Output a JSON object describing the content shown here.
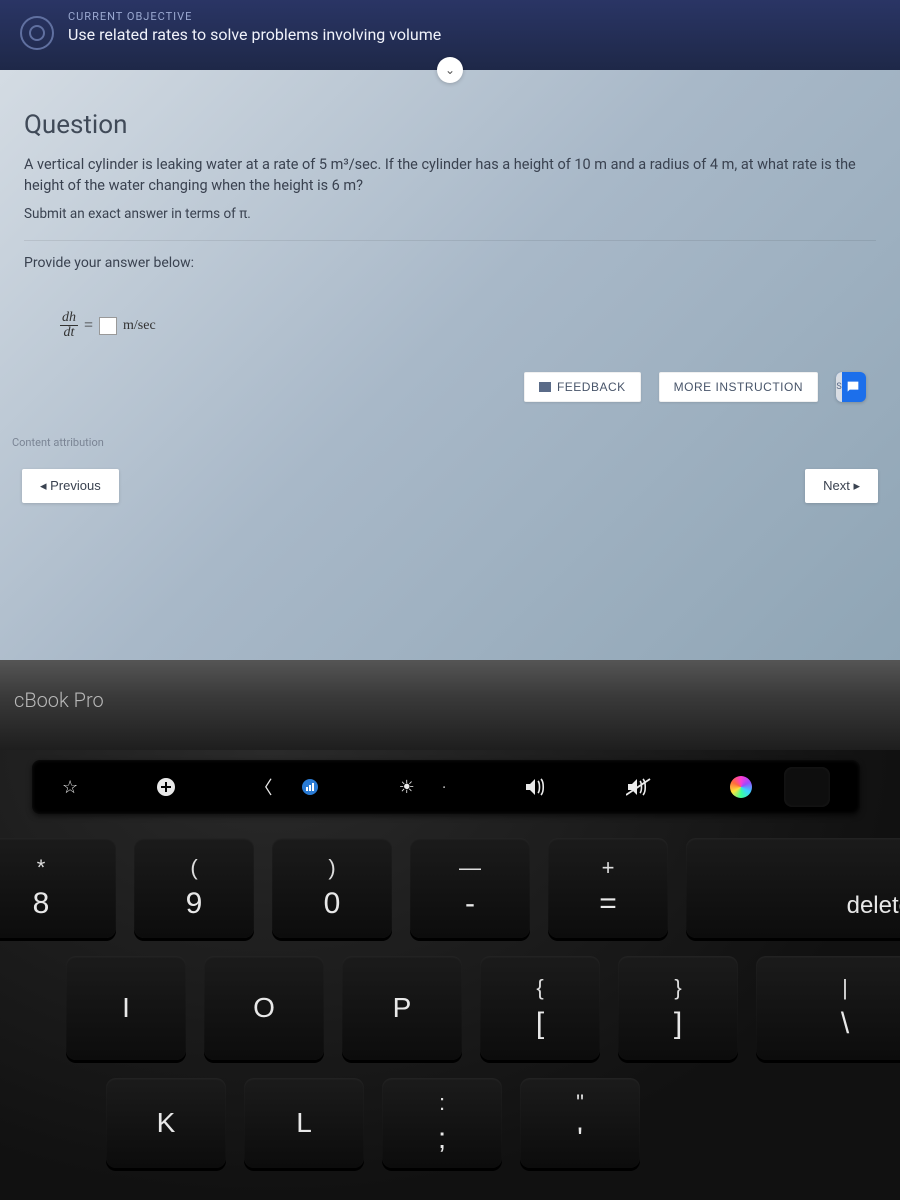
{
  "header": {
    "label": "CURRENT OBJECTIVE",
    "text": "Use related rates to solve problems involving volume"
  },
  "question": {
    "title": "Question",
    "body": "A vertical cylinder is leaking water at a rate of 5 m³/sec. If the cylinder has a height of 10 m and a radius of 4 m, at what rate is the height of the water changing when the height is 6 m?",
    "hint": "Submit an exact answer in terms of π.",
    "provide": "Provide your answer below:",
    "equation": {
      "lhs_num": "dh",
      "lhs_den": "dt",
      "eq": "=",
      "unit": "m/sec"
    }
  },
  "actions": {
    "feedback": "FEEDBACK",
    "more": "MORE INSTRUCTION",
    "sub_letter": "S"
  },
  "attribution": "Content attribution",
  "nav": {
    "prev": "◂ Previous",
    "next": "Next ▸"
  },
  "laptop_model": "cBook Pro",
  "touchbar": {
    "items": [
      "star",
      "plus",
      "back",
      "signal",
      "brightness",
      "volume",
      "mute",
      "siri"
    ]
  },
  "keyboard": {
    "row1": [
      {
        "upper": "*",
        "lower": "8"
      },
      {
        "upper": "(",
        "lower": "9"
      },
      {
        "upper": ")",
        "lower": "0"
      },
      {
        "upper": "—",
        "lower": "-"
      },
      {
        "upper": "+",
        "lower": "="
      },
      {
        "label": "delete"
      }
    ],
    "row2": [
      {
        "label": "I"
      },
      {
        "label": "O"
      },
      {
        "label": "P"
      },
      {
        "upper": "{",
        "lower": "["
      },
      {
        "upper": "}",
        "lower": "]"
      },
      {
        "upper": "|",
        "lower": "\\"
      }
    ],
    "row3": [
      {
        "label": "K"
      },
      {
        "label": "L"
      },
      {
        "upper": ":",
        "lower": ";"
      },
      {
        "upper": "\"",
        "lower": "'"
      }
    ]
  }
}
